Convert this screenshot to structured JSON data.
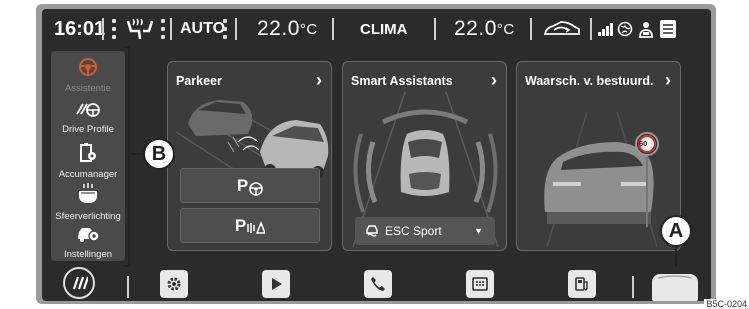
{
  "status": {
    "time": "16:01",
    "mode": "AUTO",
    "temp_left_value": "22.0",
    "temp_unit": "°C",
    "center_label": "CLIMA",
    "temp_right_value": "22.0"
  },
  "sidebar": {
    "items": [
      {
        "label": "Assistentie",
        "icon": "steering-assist-icon",
        "active": true
      },
      {
        "label": "Drive Profile",
        "icon": "drive-profile-icon"
      },
      {
        "label": "Accumanager",
        "icon": "battery-gear-icon"
      },
      {
        "label": "Sfeerverlichting",
        "icon": "ambient-light-icon"
      },
      {
        "label": "Instellingen",
        "icon": "car-settings-icon"
      }
    ]
  },
  "cards": [
    {
      "title": "Parkeer",
      "buttons": [
        "P",
        "P"
      ]
    },
    {
      "title": "Smart Assistants",
      "dropdown": "ESC Sport"
    },
    {
      "title": "Waarsch. v. bestuurd.",
      "sign": "60"
    }
  ],
  "callouts": {
    "a": "A",
    "b": "B"
  },
  "image_code": "B5C-0204",
  "colors": {
    "screen": "#2b2b2b",
    "card": "#3c3c3c",
    "accent_active": "#d65a2a"
  }
}
